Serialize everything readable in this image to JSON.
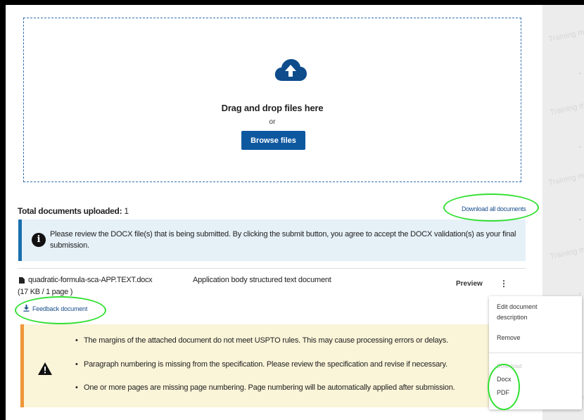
{
  "dropzone": {
    "title": "Drag and drop files here",
    "or": "or",
    "browse_label": "Browse files"
  },
  "summary": {
    "total_label": "Total documents uploaded:",
    "total_count": "1",
    "download_all": "Download all documents"
  },
  "info": {
    "icon": "info-icon",
    "text": "Please review the DOCX file(s) that is being submitted. By clicking the submit button, you agree to accept the DOCX validation(s) as your final submission."
  },
  "file": {
    "icon": "document-icon",
    "name": "quadratic-formula-sca-APP.TEXT.docx",
    "size": "(17 KB / 1 page )",
    "description": "Application body structured text document",
    "preview_label": "Preview",
    "more_label": "⋮",
    "feedback_label": "Feedback document"
  },
  "warnings": {
    "icon": "warning-triangle-icon",
    "items": [
      "The margins of the attached document do not meet USPTO rules. This may cause processing errors or delays.",
      "Paragraph numbering is missing from the specification. Please review the specification and revise if necessary.",
      "One or more pages are missing page numbering. Page numbering will be automatically applied after submission."
    ]
  },
  "menu": {
    "edit_description": "Edit document description",
    "remove": "Remove",
    "download_header": "Download",
    "docx": "Docx",
    "pdf": "PDF"
  },
  "side": {
    "watermark": "Training mode"
  },
  "colors": {
    "primary": "#0e58a0",
    "info_border": "#1a6fae",
    "warning_border": "#f0953a",
    "annotation": "#33e033"
  }
}
